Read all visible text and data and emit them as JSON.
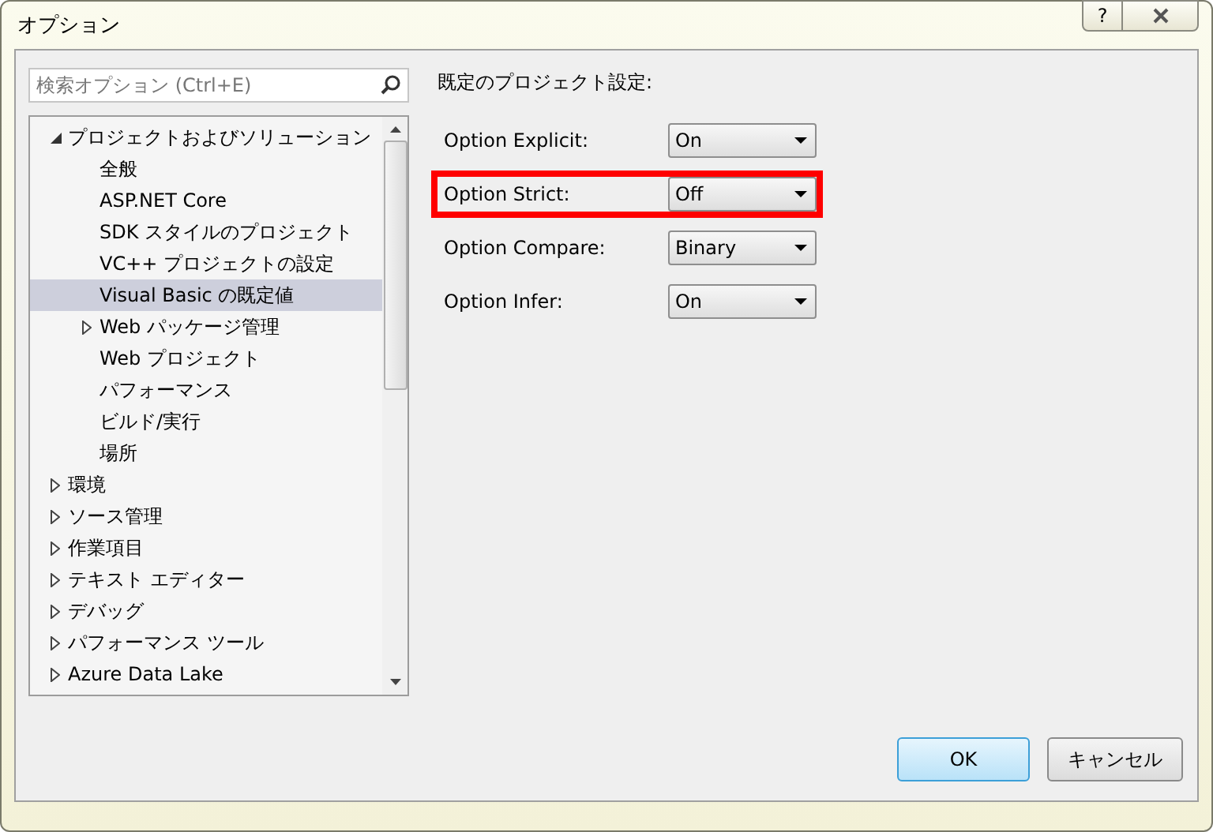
{
  "window": {
    "title": "オプション",
    "help_button": "?"
  },
  "search": {
    "placeholder": "検索オプション (Ctrl+E)"
  },
  "tree": [
    {
      "label": "プロジェクトおよびソリューション",
      "expanded": true,
      "selected": false,
      "children": [
        {
          "label": "全般",
          "selected": false
        },
        {
          "label": "ASP.NET Core",
          "selected": false
        },
        {
          "label": "SDK スタイルのプロジェクト",
          "selected": false
        },
        {
          "label": "VC++ プロジェクトの設定",
          "selected": false
        },
        {
          "label": "Visual Basic の既定値",
          "selected": true
        },
        {
          "label": "Web パッケージ管理",
          "expanded": false,
          "selected": false
        },
        {
          "label": "Web プロジェクト",
          "selected": false
        },
        {
          "label": "パフォーマンス",
          "selected": false
        },
        {
          "label": "ビルド/実行",
          "selected": false
        },
        {
          "label": "場所",
          "selected": false
        }
      ]
    },
    {
      "label": "環境",
      "expanded": false,
      "selected": false
    },
    {
      "label": "ソース管理",
      "expanded": false,
      "selected": false
    },
    {
      "label": "作業項目",
      "expanded": false,
      "selected": false
    },
    {
      "label": "テキスト エディター",
      "expanded": false,
      "selected": false
    },
    {
      "label": "デバッグ",
      "expanded": false,
      "selected": false
    },
    {
      "label": "パフォーマンス ツール",
      "expanded": false,
      "selected": false
    },
    {
      "label": "Azure Data Lake",
      "expanded": false,
      "selected": false
    }
  ],
  "settings": {
    "heading": "既定のプロジェクト設定:",
    "options": [
      {
        "label": "Option Explicit:",
        "value": "On",
        "highlighted": false
      },
      {
        "label": "Option Strict:",
        "value": "Off",
        "highlighted": true
      },
      {
        "label": "Option Compare:",
        "value": "Binary",
        "highlighted": false
      },
      {
        "label": "Option Infer:",
        "value": "On",
        "highlighted": false
      }
    ]
  },
  "buttons": [
    {
      "label": "OK",
      "kind": "default"
    },
    {
      "label": "キャンセル",
      "kind": "normal"
    }
  ]
}
